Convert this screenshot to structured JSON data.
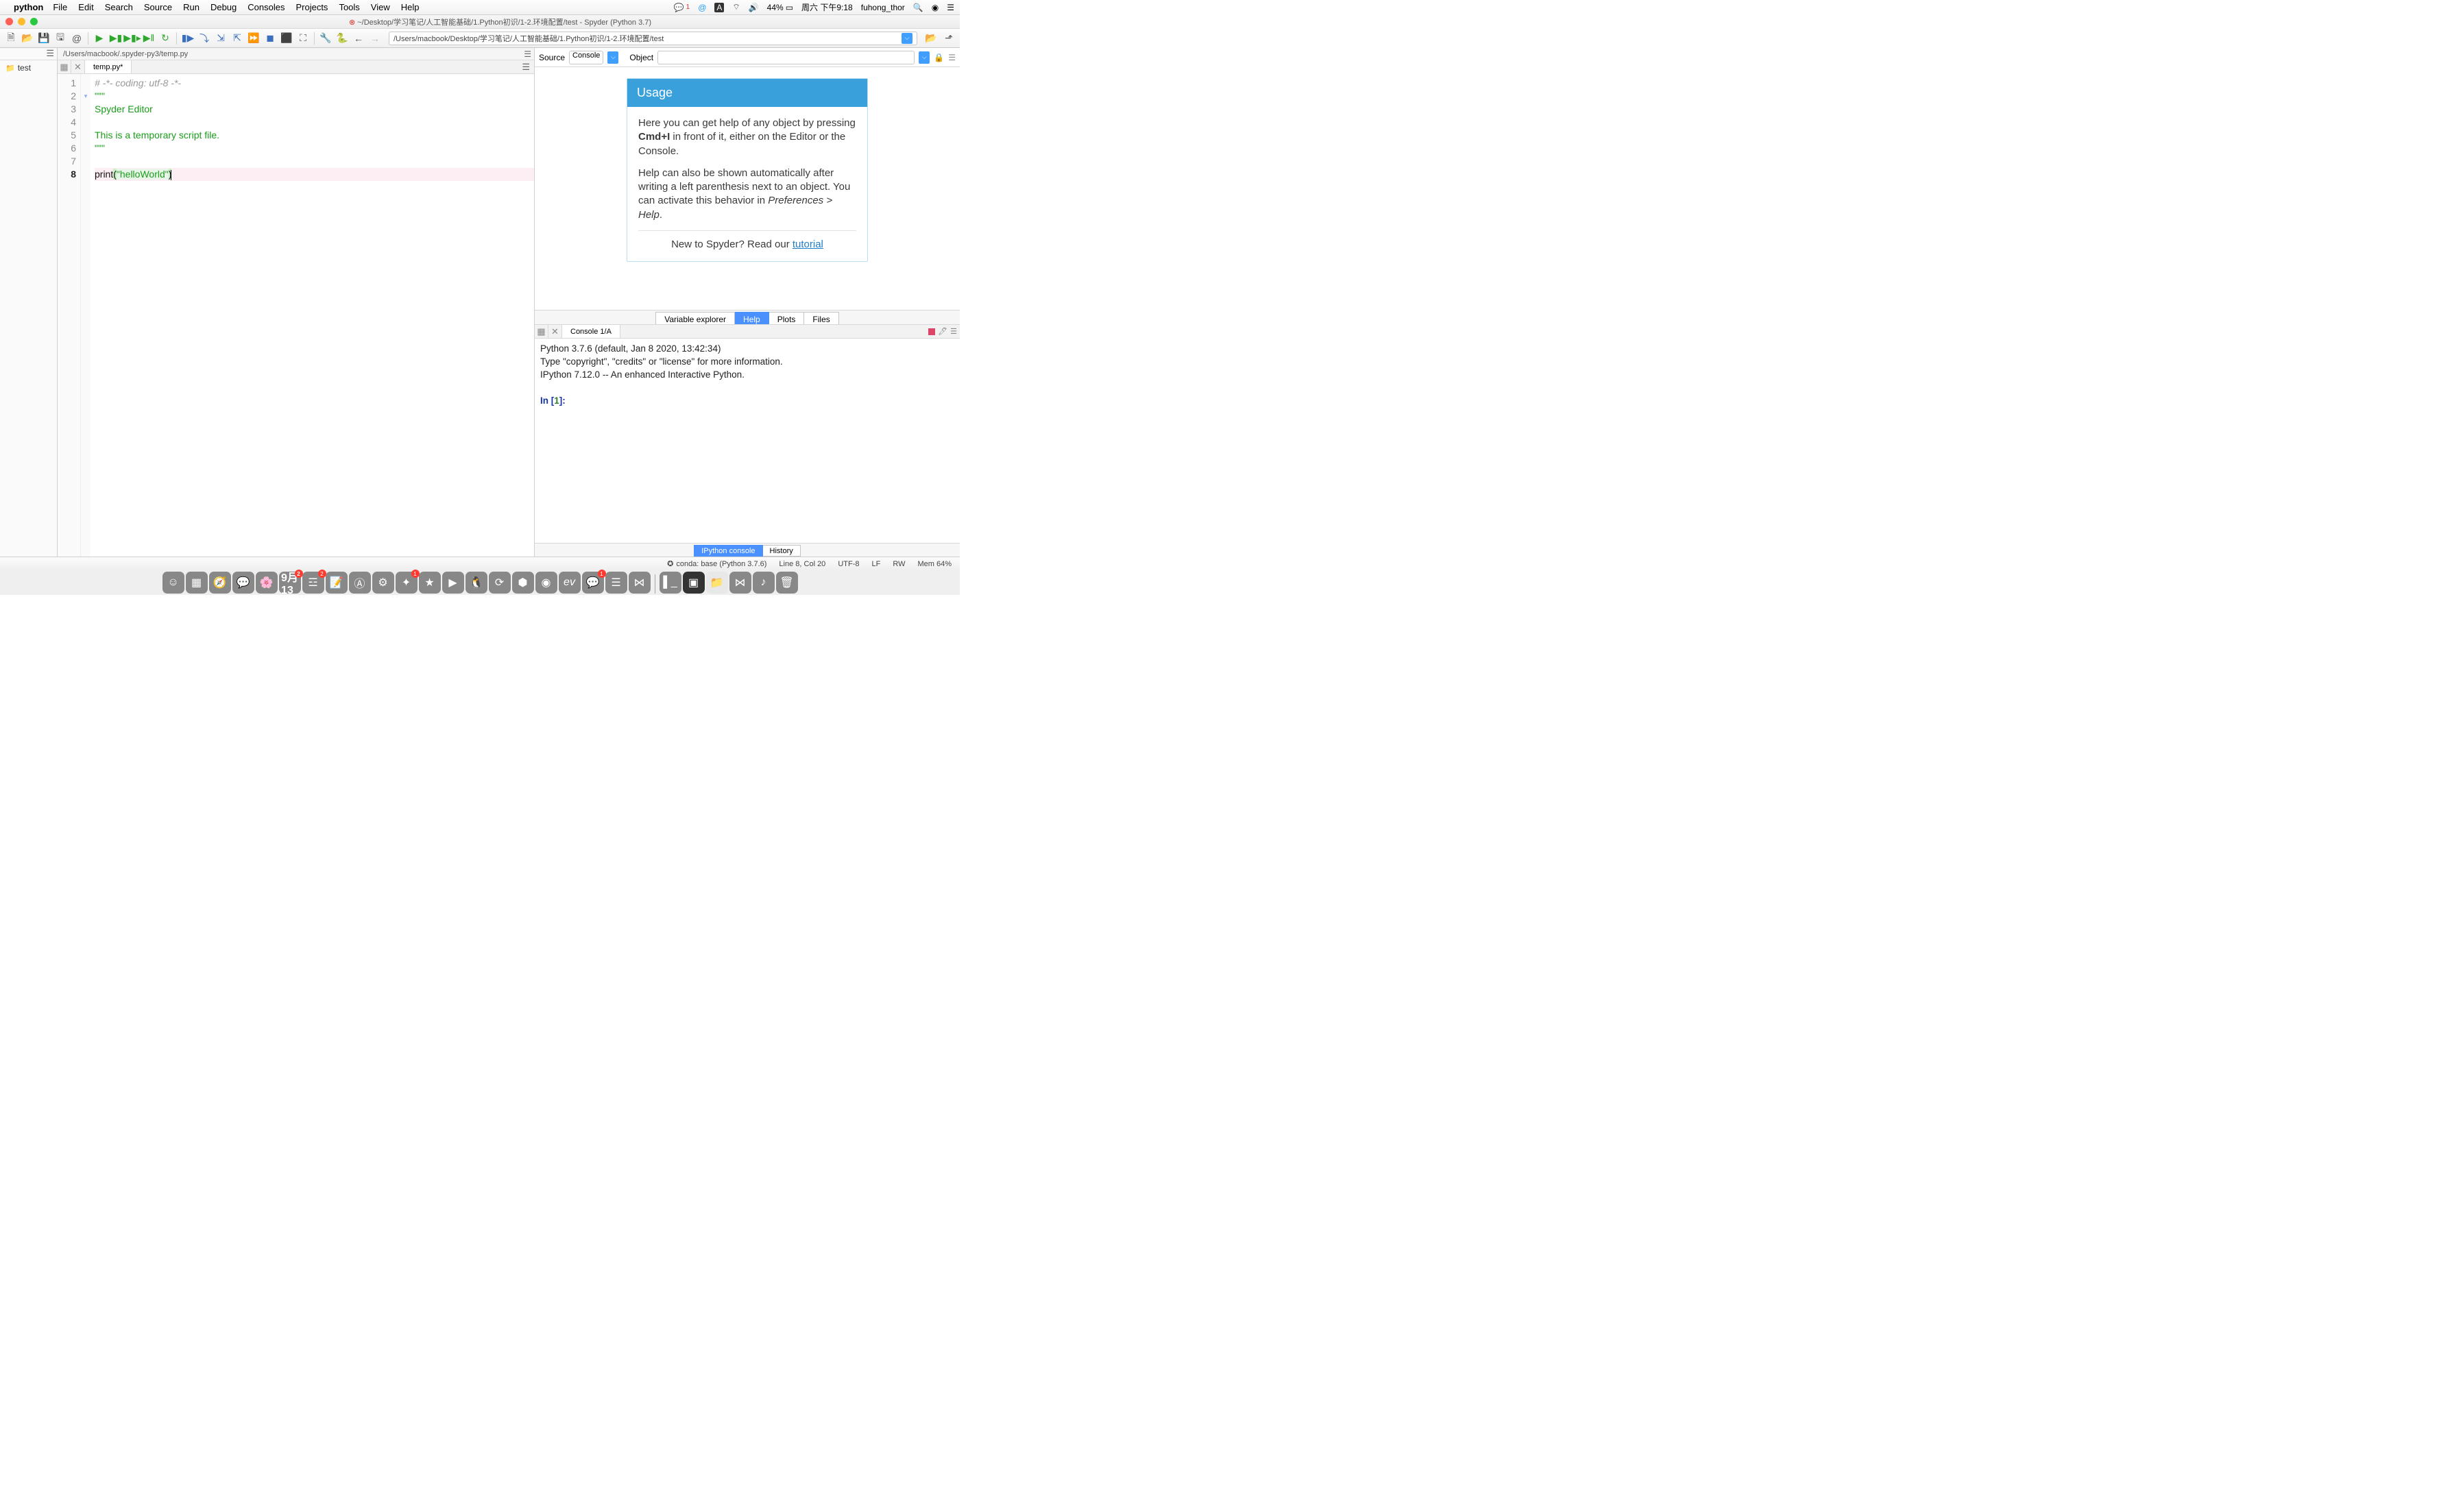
{
  "menubar": {
    "app": "python",
    "items": [
      "File",
      "Edit",
      "Search",
      "Source",
      "Run",
      "Debug",
      "Consoles",
      "Projects",
      "Tools",
      "View",
      "Help"
    ],
    "right": {
      "wechat_badge": "1",
      "input_badge": "A",
      "battery": "44%",
      "datetime": "周六 下午9:18",
      "user": "fuhong_thor"
    }
  },
  "window": {
    "title": "~/Desktop/学习笔记/人工智能基础/1.Python初识/1-2.环境配置/test - Spyder (Python 3.7)"
  },
  "toolbar": {
    "path": "/Users/macbook/Desktop/学习笔记/人工智能基础/1.Python初识/1-2.环境配置/test"
  },
  "project": {
    "root": "test"
  },
  "editor": {
    "pathbar": "/Users/macbook/.spyder-py3/temp.py",
    "tab": "temp.py*",
    "lines": [
      {
        "n": 1,
        "type": "comment",
        "text": "# -*- coding: utf-8 -*-"
      },
      {
        "n": 2,
        "type": "str",
        "text": "\"\"\"",
        "fold": true
      },
      {
        "n": 3,
        "type": "str",
        "text": "Spyder Editor"
      },
      {
        "n": 4,
        "type": "str",
        "text": ""
      },
      {
        "n": 5,
        "type": "str",
        "text": "This is a temporary script file."
      },
      {
        "n": 6,
        "type": "str",
        "text": "\"\"\""
      },
      {
        "n": 7,
        "type": "blank",
        "text": ""
      },
      {
        "n": 8,
        "type": "code",
        "current": true,
        "func": "print",
        "open": "(",
        "string": "\"helloWorld\"",
        "close": ")"
      }
    ]
  },
  "help": {
    "source_label": "Source",
    "source_value": "Console",
    "object_label": "Object",
    "usage_title": "Usage",
    "p1_a": "Here you can get help of any object by pressing ",
    "p1_kbd": "Cmd+I",
    "p1_b": " in front of it, either on the Editor or the Console.",
    "p2_a": "Help can also be shown automatically after writing a left parenthesis next to an object. You can activate this behavior in ",
    "p2_em": "Preferences > Help",
    "p2_b": ".",
    "tutorial_a": "New to Spyder? Read our ",
    "tutorial_link": "tutorial"
  },
  "right_tabs": {
    "items": [
      "Variable explorer",
      "Help",
      "Plots",
      "Files"
    ],
    "active": "Help"
  },
  "console": {
    "tab": "Console 1/A",
    "line1": "Python 3.7.6 (default, Jan  8 2020, 13:42:34) ",
    "line2": "Type \"copyright\", \"credits\" or \"license\" for more information.",
    "line3": "",
    "line4": "IPython 7.12.0 -- An enhanced Interactive Python.",
    "prompt_pre": "In [",
    "prompt_num": "1",
    "prompt_post": "]: "
  },
  "bottom_tabs": {
    "items": [
      "IPython console",
      "History"
    ],
    "active": "IPython console"
  },
  "status": {
    "conda": "conda: base (Python 3.7.6)",
    "pos": "Line 8, Col 20",
    "enc": "UTF-8",
    "eol": "LF",
    "rw": "RW",
    "mem": "Mem 64%"
  },
  "dock": {
    "cal_day": "13",
    "cal_badge": "2",
    "remind_badge": "2",
    "final_badge": "1",
    "wx_badge": "1"
  }
}
